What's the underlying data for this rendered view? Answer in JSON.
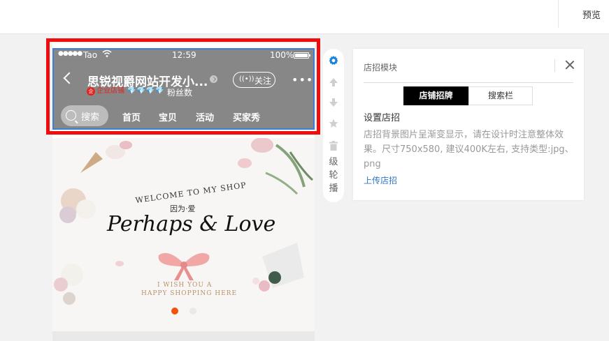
{
  "topbar": {
    "preview_label": "预览"
  },
  "status_bar": {
    "dots": "●●●●●",
    "carrier": "Tao",
    "time": "12:59",
    "battery": "100%"
  },
  "shop_header": {
    "name": "思锐视爵网站开发小...",
    "follow_label": "关注",
    "more": "•••",
    "enterprise_label": "企业店铺",
    "diamonds": "💎💎💎💎",
    "fans_label": "粉丝数"
  },
  "shop_nav": {
    "search_label": "搜索",
    "items": [
      "首页",
      "宝贝",
      "活动",
      "买家秀"
    ]
  },
  "banner": {
    "welcome": "WELCOME TO MY SHOP",
    "subtitle": "因为·爱",
    "script_title": "Perhaps & Love",
    "wish_line1": "I WISH YOU A",
    "wish_line2": "HAPPY SHOPPING HERE",
    "active_dot_color": "#f2520a"
  },
  "side_toolbar": {
    "icons": [
      "gear-icon",
      "arrow-up-icon",
      "arrow-down-icon",
      "star-icon",
      "trash-icon"
    ],
    "vertical_text": [
      "级",
      "轮",
      "播"
    ],
    "accent_color": "#1a82d8"
  },
  "panel": {
    "title": "店招模块",
    "tabs": [
      "店铺招牌",
      "搜索栏"
    ],
    "subhead": "设置店招",
    "description": "店招背景图片呈渐变显示，请在设计时注意整体效果。尺寸750x580, 建议400K左右, 支持类型:jpg、png",
    "upload_link": "上传店招",
    "link_color": "#3078c9"
  },
  "selection": {
    "outer_color": "#f00d0d",
    "inner_color": "#3d7fd6"
  }
}
